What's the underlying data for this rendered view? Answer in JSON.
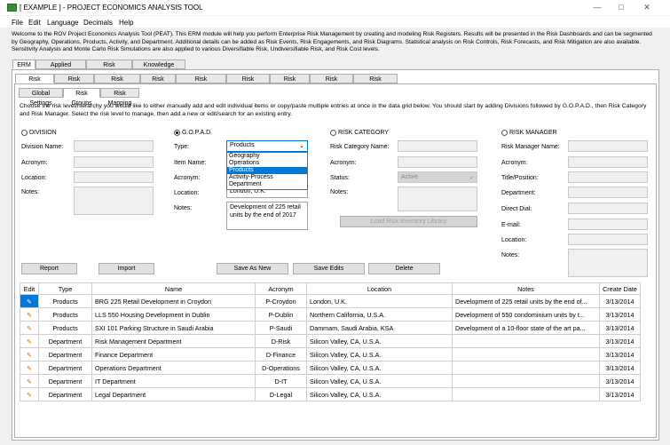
{
  "window": {
    "title": "[ EXAMPLE ] - PROJECT ECONOMICS ANALYSIS TOOL"
  },
  "menu": [
    "File",
    "Edit",
    "Language",
    "Decimals",
    "Help"
  ],
  "intro_text": "Welcome to the ROV Project Economics Analysis Tool (PEAT). This ERM module will help you perform Enterprise Risk Management by creating and modeling Risk Registers. Results will be presented in the Risk Dashboards and can be segmented by Geography, Operations, Products, Activity, and Department. Additional details can be added as Risk Events, Risk Engagements, and Risk Diagrams. Statistical analysis on Risk Controls, Risk Forecasts, and Risk Mitigation are also available. Sensitivity Analysis and Monte Carlo Risk Simulations are also applied to various Diversifiable Risk, Undiversifiable Risk, and Risk Cost levels.",
  "main_tabs": [
    "ERM",
    "Applied Analytics",
    "Risk Simulation",
    "Knowledge Center"
  ],
  "sub_tabs": [
    "Risk Settings",
    "Risk Register",
    "Risk Dashboard",
    "Risk Events",
    "Risk Engagement",
    "Risk Diagrams",
    "Risk Controls",
    "Risk Forecasts",
    "Risk Mitigation"
  ],
  "sub_sub_tabs": [
    "Global Settings",
    "Risk Groups",
    "Risk Mapping"
  ],
  "instructions": "Choose the risk level/hierarchy you would like to either manually add and edit individual items or copy/paste multiple entries at once in the data grid below. You should start by adding Divisions followed by G.O.P.A.D., then Risk Category and Risk Manager. Select the risk level to manage, then add a new or edit/search for an existing entry.",
  "division": {
    "title": "DIVISION",
    "labels": [
      "Division Name:",
      "Acronym:",
      "Location:",
      "Notes:"
    ]
  },
  "gopad": {
    "title": "G.O.P.A.D.",
    "type_label": "Type:",
    "type_value": "Products",
    "options": [
      "Geography",
      "Operations",
      "Products",
      "Activity-Process",
      "Department"
    ],
    "item_label": "Item Name:",
    "acronym_label": "Acronym:",
    "acronym_value": "",
    "location_label": "Location:",
    "location_value": "London, U.K.",
    "notes_label": "Notes:",
    "notes_value": "Development of 225 retail units by the end of 2017"
  },
  "risk_category": {
    "title": "RISK CATEGORY",
    "labels": [
      "Risk Category Name:",
      "Acronym:",
      "Status:",
      "Notes:"
    ],
    "status_value": "Active",
    "load_button": "Load Risk Inventory Library"
  },
  "risk_manager": {
    "title": "RISK MANAGER",
    "labels": [
      "Risk Manager Name:",
      "Acronym:",
      "Title/Position:",
      "Department:",
      "Direct Dial:",
      "E-mail:",
      "Location:",
      "Notes:"
    ]
  },
  "buttons": {
    "report": "Report",
    "import": "Import",
    "save_as_new": "Save As New",
    "save_edits": "Save Edits",
    "delete": "Delete"
  },
  "table": {
    "headers": [
      "Edit",
      "Type",
      "Name",
      "Acronym",
      "Location",
      "Notes",
      "Create Date"
    ],
    "rows": [
      [
        "Products",
        "BRG 225 Retail Development in Croydon",
        "P-Croydon",
        "London, U.K.",
        "Development of 225 retail units by the end of...",
        "3/13/2014"
      ],
      [
        "Products",
        "LLS 550 Housing Development in Dublin",
        "P-Dublin",
        "Northern California, U.S.A.",
        "Development of 550 condominium units by t...",
        "3/13/2014"
      ],
      [
        "Products",
        "SXI 101 Parking Structure in Saudi Arabia",
        "P-Saudi",
        "Dammam, Saudi Arabia, KSA",
        "Development of a 10-floor state of the art pa...",
        "3/13/2014"
      ],
      [
        "Department",
        "Risk Management Department",
        "D-Risk",
        "Silicon Valley, CA, U.S.A.",
        "",
        "3/13/2014"
      ],
      [
        "Department",
        "Finance Department",
        "D-Finance",
        "Silicon Valley, CA, U.S.A.",
        "",
        "3/13/2014"
      ],
      [
        "Department",
        "Operations Department",
        "D-Operations",
        "Silicon Valley, CA, U.S.A.",
        "",
        "3/13/2014"
      ],
      [
        "Department",
        "IT Department",
        "D-IT",
        "Silicon Valley, CA, U.S.A.",
        "",
        "3/13/2014"
      ],
      [
        "Department",
        "Legal Department",
        "D-Legal",
        "Silicon Valley, CA, U.S.A.",
        "",
        "3/13/2014"
      ]
    ]
  }
}
